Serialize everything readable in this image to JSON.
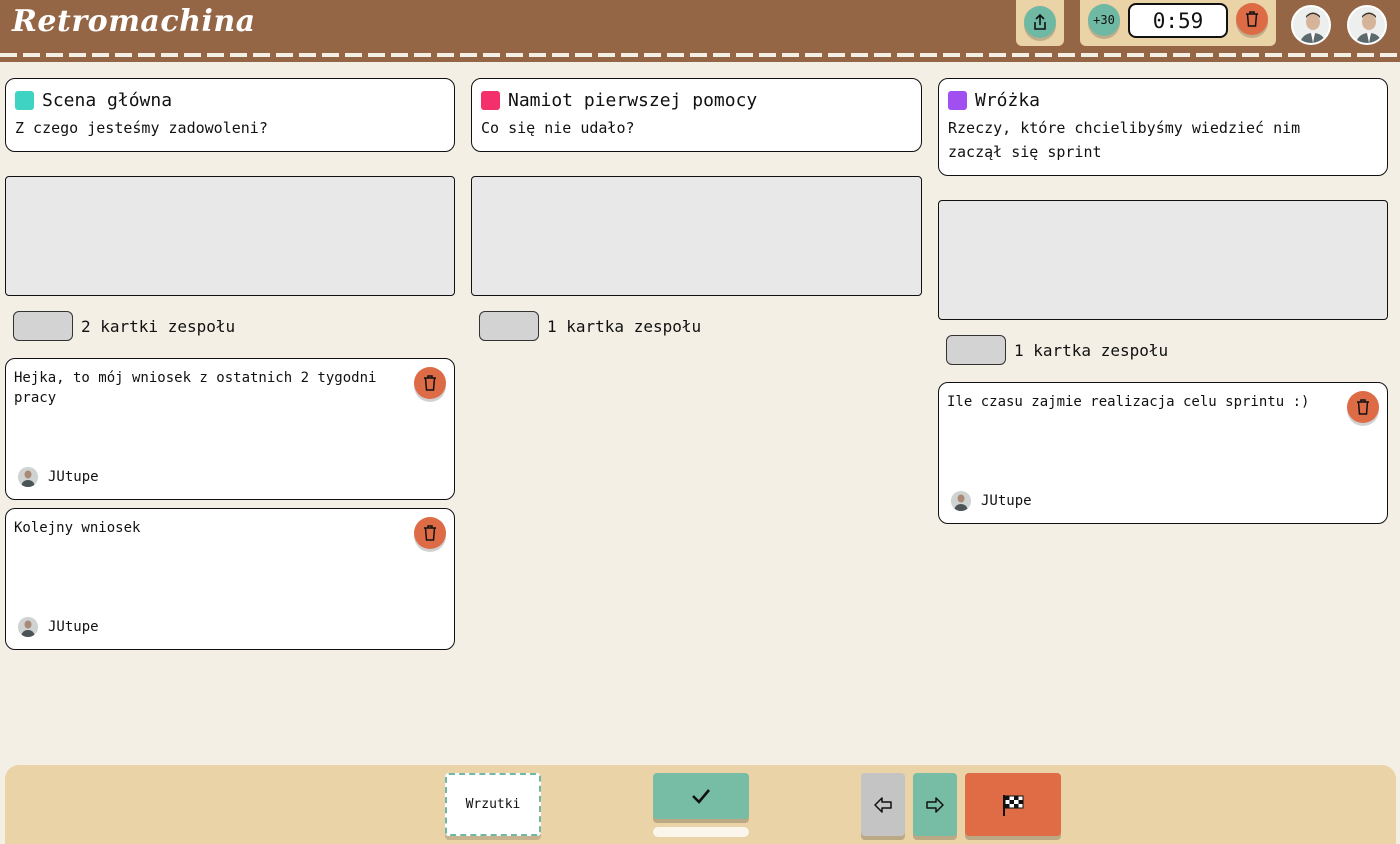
{
  "app": {
    "logo": "Retromachina",
    "accent": "#946646"
  },
  "timer": {
    "add_label": "+30",
    "value": "0:59"
  },
  "icons": {
    "share": "share-icon",
    "trash": "trash-icon",
    "check": "check-icon",
    "prev": "arrow-left-icon",
    "next": "arrow-right-icon",
    "finish": "checkered-flag-icon"
  },
  "columns": [
    {
      "title": "Scena główna",
      "subtitle": "Z czego jesteśmy zadowoleni?",
      "color": "#3ed3c2",
      "count_label": "2 kartki zespołu",
      "cards": [
        {
          "text": "Hejka, to mój wniosek z ostatnich 2 tygodni pracy",
          "author": "JUtupe"
        },
        {
          "text": "Kolejny wniosek",
          "author": "JUtupe"
        }
      ]
    },
    {
      "title": "Namiot pierwszej pomocy",
      "subtitle": "Co się nie udało?",
      "color": "#f3306a",
      "count_label": "1 kartka zespołu",
      "cards": []
    },
    {
      "title": "Wróżka",
      "subtitle": "Rzeczy, które chcielibyśmy wiedzieć nim zaczął się sprint",
      "color": "#a24ff2",
      "count_label": "1 kartka zespołu",
      "cards": [
        {
          "text": "Ile czasu zajmie realizacja celu sprintu :)",
          "author": "JUtupe"
        }
      ]
    }
  ],
  "footer": {
    "wrzutki_label": "Wrzutki"
  }
}
